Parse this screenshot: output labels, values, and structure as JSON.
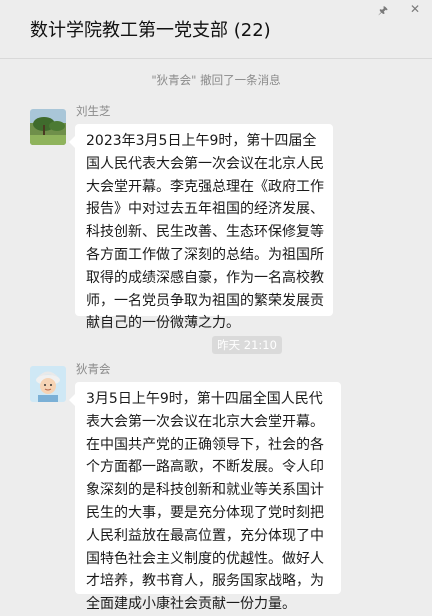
{
  "header": {
    "title": "数计学院教工第一党支部 (22)",
    "pin_icon": "pin-icon",
    "close_icon": "close-icon"
  },
  "system_notice": "\"狄青会\" 撤回了一条消息",
  "timestamp": "昨天 21:10",
  "messages": [
    {
      "sender": "刘生芝",
      "avatar": "landscape-photo",
      "text": "2023年3月5日上午9时，第十四届全国人民代表大会第一次会议在北京人民大会堂开幕。李克强总理在《政府工作报告》中对过去五年祖国的经济发展、科技创新、民生改善、生态环保修复等各方面工作做了深刻的总结。为祖国所取得的成绩深感自豪，作为一名高校教师，一名党员争取为祖国的繁荣发展贡献自己的一份微薄之力。"
    },
    {
      "sender": "狄青会",
      "avatar": "cartoon-person",
      "text": "3月5日上午9时，第十四届全国人民代表大会第一次会议在北京大会堂开幕。在中国共产党的正确领导下，社会的各个方面都一路高歌，不断发展。令人印象深刻的是科技创新和就业等关系国计民生的大事，要是充分体现了党时刻把人民利益放在最高位置，充分体现了中国特色社会主义制度的优越性。做好人才培养，教书育人，服务国家战略，为全面建成小康社会贡献一份力量。"
    }
  ],
  "colors": {
    "background": "#ededed",
    "bubble": "#ffffff",
    "meta_text": "#8a8a8a"
  }
}
